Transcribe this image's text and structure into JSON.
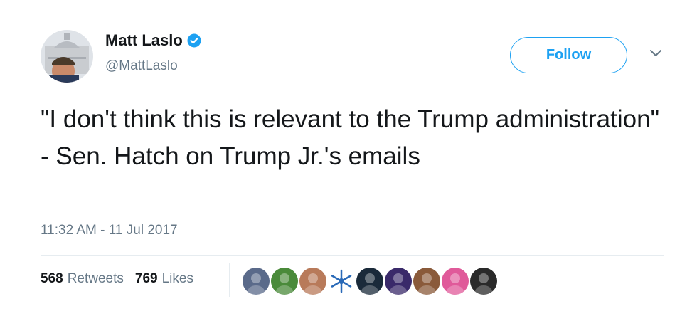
{
  "author": {
    "display_name": "Matt Laslo",
    "handle": "@MattLaslo",
    "verified": true
  },
  "follow_button": {
    "label": "Follow"
  },
  "tweet": {
    "text": "\"I don't think this is relevant to the Trump administration\" - Sen. Hatch on Trump Jr.'s emails",
    "timestamp": "11:32 AM - 11 Jul 2017"
  },
  "stats": {
    "retweets_count": "568",
    "retweets_label": "Retweets",
    "likes_count": "769",
    "likes_label": "Likes"
  },
  "likers": [
    {
      "name": "liker-avatar-1",
      "color": "#5a6a8a"
    },
    {
      "name": "liker-avatar-2",
      "color": "#4a8a3a"
    },
    {
      "name": "liker-avatar-3",
      "color": "#b87a5a"
    },
    {
      "name": "liker-avatar-4",
      "color": "#2a6ab8"
    },
    {
      "name": "liker-avatar-5",
      "color": "#1a2a3a"
    },
    {
      "name": "liker-avatar-6",
      "color": "#3a2a6a"
    },
    {
      "name": "liker-avatar-7",
      "color": "#8a5a3a"
    },
    {
      "name": "liker-avatar-8",
      "color": "#e05a9a"
    },
    {
      "name": "liker-avatar-9",
      "color": "#2a2a2a"
    }
  ],
  "colors": {
    "accent": "#1da1f2",
    "secondary_text": "#657786",
    "primary_text": "#14171a",
    "divider": "#e6ecf0"
  }
}
